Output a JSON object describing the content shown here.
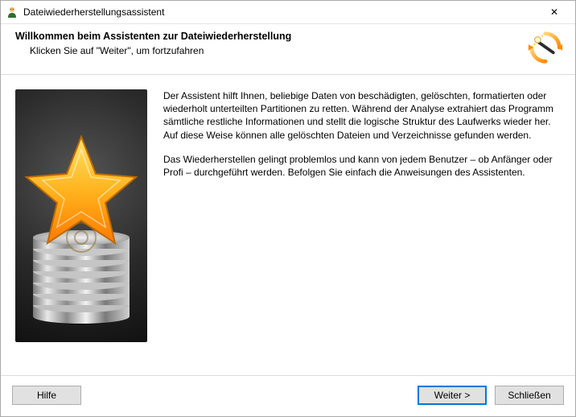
{
  "titlebar": {
    "title": "Dateiwiederherstellungsassistent"
  },
  "header": {
    "heading": "Willkommen beim Assistenten zur Dateiwiederherstellung",
    "subheading": "Klicken Sie auf \"Weiter\", um fortzufahren"
  },
  "body": {
    "paragraph1": "Der Assistent hilft Ihnen, beliebige Daten von beschädigten, gelöschten, formatierten oder wiederholt unterteilten Partitionen zu retten. Während der Analyse extrahiert das Programm sämtliche restliche Informationen und stellt die logische Struktur des Laufwerks wieder her. Auf diese Weise können alle gelöschten Dateien und Verzeichnisse gefunden werden.",
    "paragraph2": "Das Wiederherstellen gelingt problemlos und kann von jedem Benutzer – ob Anfänger oder Profi – durchgeführt werden. Befolgen Sie einfach die Anweisungen des Assistenten."
  },
  "footer": {
    "help": "Hilfe",
    "next": "Weiter >",
    "close": "Schließen"
  },
  "icons": {
    "app": "app-icon",
    "wizard": "magic-wand-icon",
    "illustration": "star-on-disks-icon",
    "close_x": "✕"
  },
  "colors": {
    "accent": "#0078d7",
    "star_fill_a": "#ffd24a",
    "star_fill_b": "#ff8c00"
  }
}
